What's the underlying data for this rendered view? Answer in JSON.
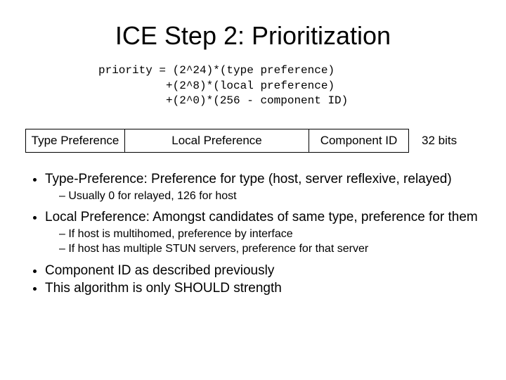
{
  "title": "ICE Step 2: Prioritization",
  "formula": "priority = (2^24)*(type preference)\n          +(2^8)*(local preference)\n          +(2^0)*(256 - component ID)",
  "fields": {
    "type": "Type Preference",
    "local": "Local Preference",
    "component": "Component ID",
    "bits": "32 bits"
  },
  "bullets": {
    "b1": "Type-Preference: Preference for type (host, server reflexive, relayed)",
    "b1_sub1": "Usually 0 for relayed, 126 for host",
    "b2": "Local Preference: Amongst candidates of same type, preference for them",
    "b2_sub1": "If host is multihomed, preference by interface",
    "b2_sub2": "If host has multiple STUN servers, preference for that server",
    "b3": "Component ID as described previously",
    "b4": "This algorithm is only SHOULD strength"
  }
}
